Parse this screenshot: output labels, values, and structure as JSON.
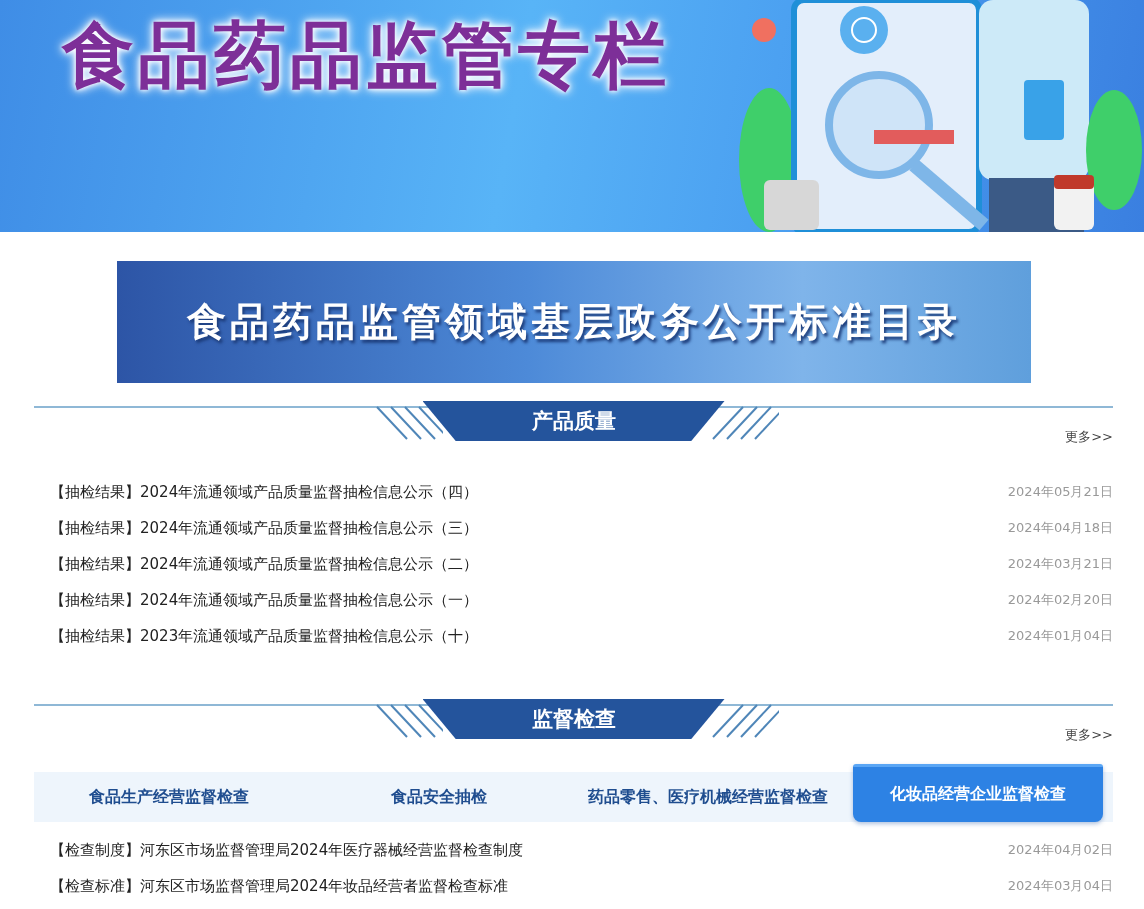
{
  "header": {
    "title": "食品药品监管专栏"
  },
  "catalog_banner": {
    "title": "食品药品监管领域基层政务公开标准目录"
  },
  "sections": [
    {
      "title": "产品质量",
      "more": "更多>>",
      "items": [
        {
          "tag": "【抽检结果】",
          "text": "2024年流通领域产品质量监督抽检信息公示（四）",
          "date": "2024年05月21日"
        },
        {
          "tag": "【抽检结果】",
          "text": "2024年流通领域产品质量监督抽检信息公示（三）",
          "date": "2024年04月18日"
        },
        {
          "tag": "【抽检结果】",
          "text": "2024年流通领域产品质量监督抽检信息公示（二）",
          "date": "2024年03月21日"
        },
        {
          "tag": "【抽检结果】",
          "text": "2024年流通领域产品质量监督抽检信息公示（一）",
          "date": "2024年02月20日"
        },
        {
          "tag": "【抽检结果】",
          "text": "2023年流通领域产品质量监督抽检信息公示（十）",
          "date": "2024年01月04日"
        }
      ]
    },
    {
      "title": "监督检查",
      "more": "更多>>",
      "tabs": [
        {
          "label": "食品生产经营监督检查",
          "selected": false
        },
        {
          "label": "食品安全抽检",
          "selected": false
        },
        {
          "label": "药品零售、医疗机械经营监督检查",
          "selected": false
        },
        {
          "label": "化妆品经营企业监督检查",
          "selected": true
        }
      ],
      "items": [
        {
          "tag": "【检查制度】",
          "text": "河东区市场监督管理局2024年医疗器械经营监督检查制度",
          "date": "2024年04月02日"
        },
        {
          "tag": "【检查标准】",
          "text": "河东区市场监督管理局2024年妆品经营者监督检查标准",
          "date": "2024年03月04日"
        }
      ]
    }
  ]
}
